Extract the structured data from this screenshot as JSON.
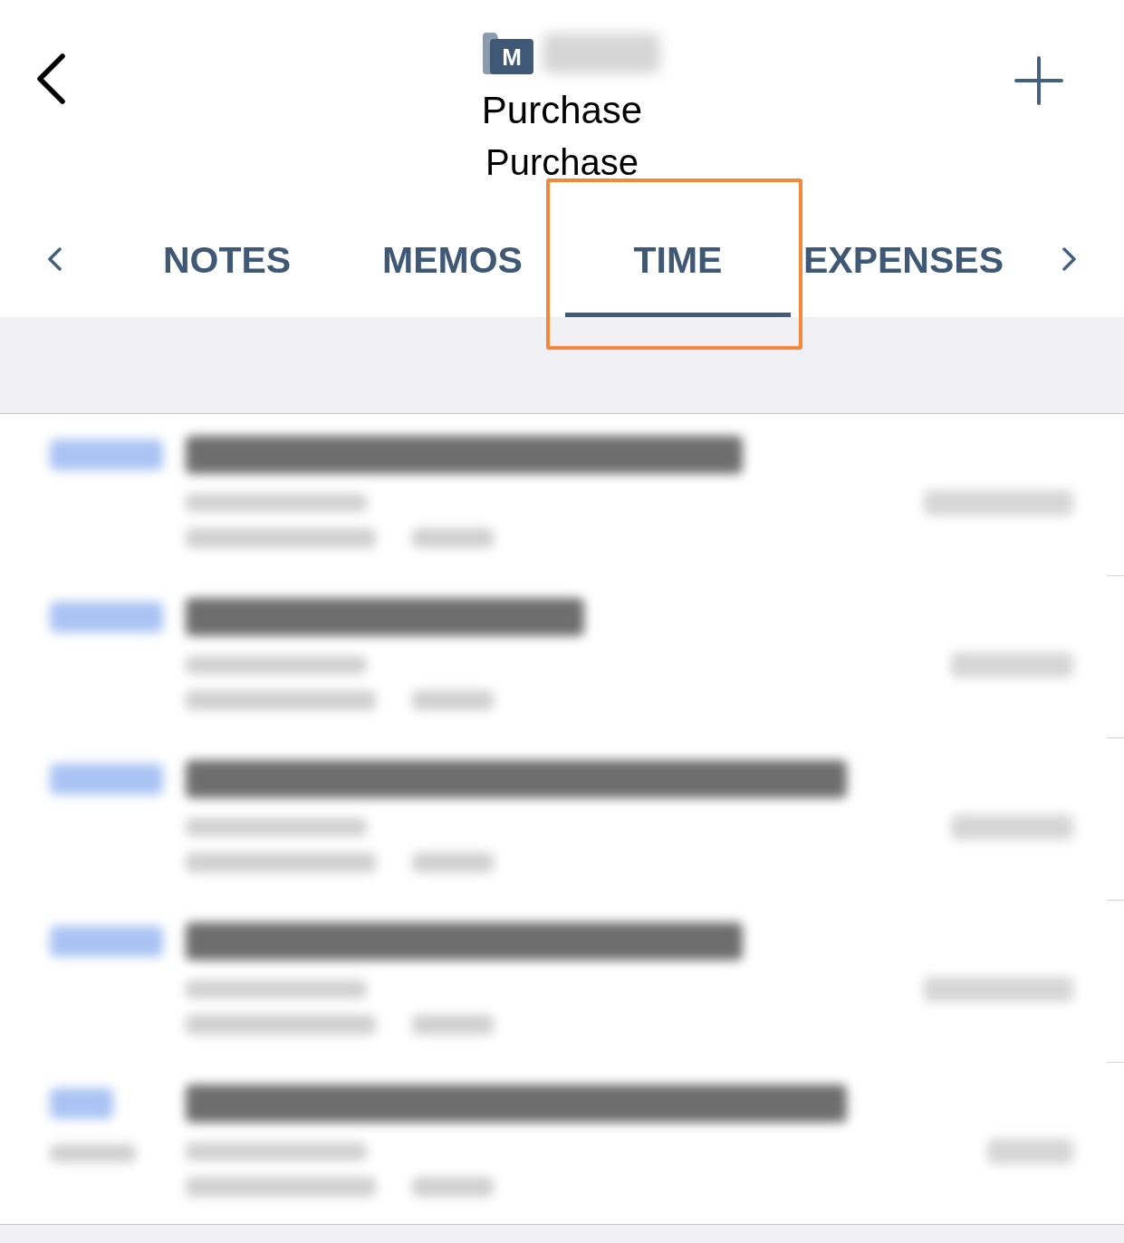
{
  "header": {
    "logo_letter": "M",
    "title_lines": [
      "Purchase",
      "Purchase"
    ]
  },
  "tabs": [
    {
      "label": "NOTES",
      "selected": false,
      "highlighted": false
    },
    {
      "label": "MEMOS",
      "selected": false,
      "highlighted": false
    },
    {
      "label": "TIME",
      "selected": true,
      "highlighted": true
    },
    {
      "label": "EXPENSES",
      "selected": false,
      "highlighted": false
    }
  ],
  "entries": [
    {
      "kind": "fixed"
    },
    {
      "kind": "fixed"
    },
    {
      "kind": "fixed"
    },
    {
      "kind": "fixed"
    },
    {
      "kind": "bill"
    }
  ]
}
